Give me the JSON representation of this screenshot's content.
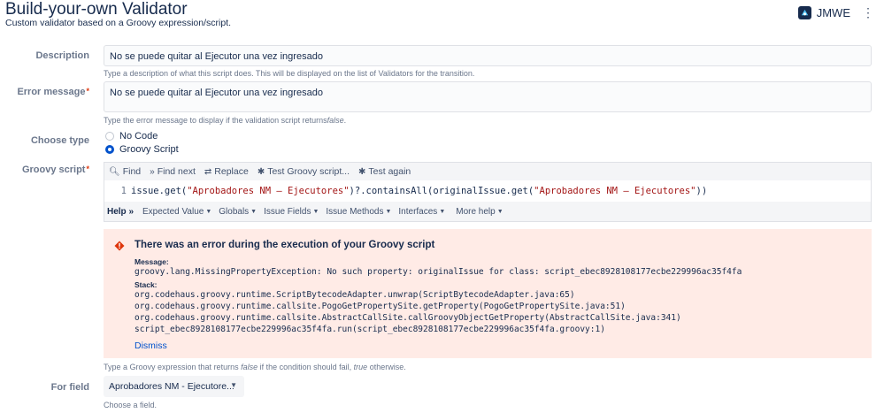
{
  "header": {
    "title": "Build-your-own Validator",
    "subtitle": "Custom validator based on a Groovy expression/script.",
    "app_label": "JMWE",
    "menu_icon": "more-vertical-icon"
  },
  "description": {
    "label": "Description",
    "value": "No se puede quitar al Ejecutor una vez ingresado",
    "help": "Type a description of what this script does. This will be displayed on the list of Validators for the transition."
  },
  "error_message": {
    "label": "Error message",
    "value": "No se puede quitar al Ejecutor una vez ingresado",
    "help_prefix": "Type the error message to display if the validation script returns",
    "help_italic": "false",
    "help_suffix": "."
  },
  "choose_type": {
    "label": "Choose type",
    "options": [
      {
        "label": "No Code",
        "checked": false
      },
      {
        "label": "Groovy Script",
        "checked": true
      }
    ]
  },
  "groovy_script": {
    "label": "Groovy script",
    "toolbar": {
      "find": "Find",
      "find_next": "Find next",
      "replace": "Replace",
      "test_script": "Test Groovy script...",
      "test_again": "Test again"
    },
    "line_number": "1",
    "code": {
      "p1": "issue.get(",
      "s1": "\"Aprobadores NM – Ejecutores\"",
      "p2": ")?.containsAll(originalIssue.get(",
      "s2": "\"Aprobadores NM – Ejecutores\"",
      "p3": "))"
    },
    "help_bar": {
      "title": "Help »",
      "menus": [
        "Expected Value",
        "Globals",
        "Issue Fields",
        "Issue Methods",
        "Interfaces",
        "More help"
      ]
    }
  },
  "error_box": {
    "title": "There was an error during the execution of your Groovy script",
    "message_label": "Message:",
    "message": "groovy.lang.MissingPropertyException: No such property: originalIssue for class: script_ebec8928108177ecbe229996ac35f4fa",
    "stack_label": "Stack:",
    "stack": [
      "org.codehaus.groovy.runtime.ScriptBytecodeAdapter.unwrap(ScriptBytecodeAdapter.java:65)",
      "org.codehaus.groovy.runtime.callsite.PogoGetPropertySite.getProperty(PogoGetPropertySite.java:51)",
      "org.codehaus.groovy.runtime.callsite.AbstractCallSite.callGroovyObjectGetProperty(AbstractCallSite.java:341)",
      "script_ebec8928108177ecbe229996ac35f4fa.run(script_ebec8928108177ecbe229996ac35f4fa.groovy:1)"
    ],
    "dismiss": "Dismiss"
  },
  "script_help": {
    "p1": "Type a Groovy expression that returns ",
    "i1": "false",
    "p2": " if the condition should fail, ",
    "i2": "true",
    "p3": " otherwise."
  },
  "for_field": {
    "label": "For field",
    "value": "Aprobadores NM - Ejecutore...",
    "help": "Choose a field."
  },
  "colors": {
    "accent": "#0052cc",
    "error_bg": "#ffebe6",
    "required": "#de350b",
    "code_string": "#a31515"
  }
}
